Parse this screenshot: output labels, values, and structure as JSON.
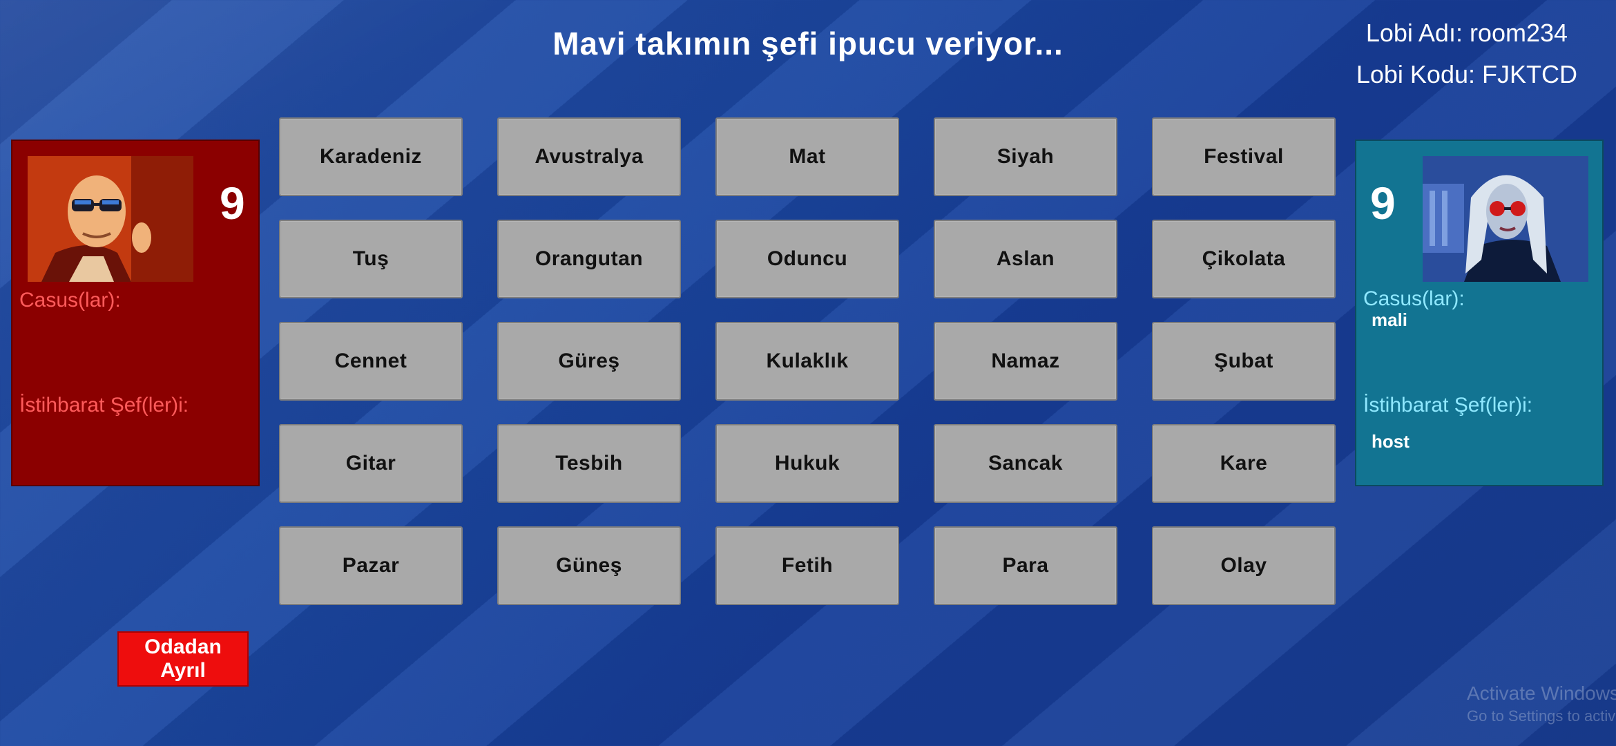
{
  "header": {
    "status": "Mavi takımın şefi ipucu veriyor...",
    "lobby_name_line": "Lobi Adı: room234",
    "lobby_code_line": "Lobi Kodu: FJKTCD"
  },
  "red_team": {
    "score": "9",
    "spies_label": "Casus(lar):",
    "chiefs_label": "İstihbarat Şef(ler)i:",
    "spies": [],
    "chiefs": []
  },
  "blue_team": {
    "score": "9",
    "spies_label": "Casus(lar):",
    "chiefs_label": "İstihbarat Şef(ler)i:",
    "spies": [
      "mali"
    ],
    "chiefs": [
      "host"
    ]
  },
  "board": {
    "words": [
      "Karadeniz",
      "Avustralya",
      "Mat",
      "Siyah",
      "Festival",
      "Tuş",
      "Orangutan",
      "Oduncu",
      "Aslan",
      "Çikolata",
      "Cennet",
      "Güreş",
      "Kulaklık",
      "Namaz",
      "Şubat",
      "Gitar",
      "Tesbih",
      "Hukuk",
      "Sancak",
      "Kare",
      "Pazar",
      "Güneş",
      "Fetih",
      "Para",
      "Olay"
    ]
  },
  "leave_button": {
    "label": "Odadan\nAyrıl"
  },
  "colors": {
    "red_team": "#8b0000",
    "blue_team": "#127492",
    "card": "#a9a9a9",
    "leave_button": "#ee0d0d"
  },
  "watermark": {
    "line1": "Activate Windows",
    "line2": "Go to Settings to activate Windows."
  }
}
